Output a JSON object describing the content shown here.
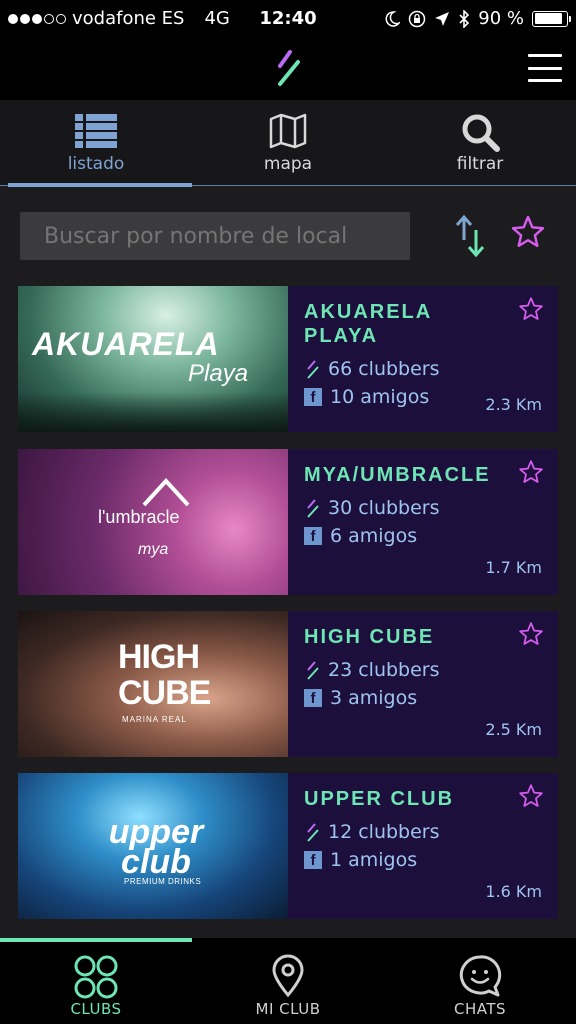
{
  "status_bar": {
    "carrier": "vodafone ES",
    "network": "4G",
    "time": "12:40",
    "battery": "90 %",
    "battery_level": 0.9
  },
  "tabs": [
    {
      "label": "listado",
      "icon": "list-icon",
      "active": true
    },
    {
      "label": "mapa",
      "icon": "map-icon",
      "active": false
    },
    {
      "label": "filtrar",
      "icon": "search-icon",
      "active": false
    }
  ],
  "search": {
    "placeholder": "Buscar por nombre de local",
    "value": ""
  },
  "clubs": [
    {
      "name": "AKUARELA PLAYA",
      "clubbers": "66 clubbers",
      "amigos": "10 amigos",
      "distance": "2.3 Km",
      "image_text": "AKUARELA",
      "image_subtext": "Playa"
    },
    {
      "name": "MYA/UMBRACLE",
      "clubbers": "30 clubbers",
      "amigos": "6 amigos",
      "distance": "1.7 Km",
      "image_text": "l'umbracle",
      "image_subtext": "mya"
    },
    {
      "name": "HIGH CUBE",
      "clubbers": "23 clubbers",
      "amigos": "3 amigos",
      "distance": "2.5 Km",
      "image_text": "HIGH CUBE",
      "image_subtext": "MARINA REAL"
    },
    {
      "name": "UPPER CLUB",
      "clubbers": "12 clubbers",
      "amigos": "1 amigos",
      "distance": "1.6 Km",
      "image_text": "upper club",
      "image_subtext": "PREMIUM DRINKS"
    }
  ],
  "bottom_nav": [
    {
      "label": "CLUBS",
      "icon": "clubs-icon",
      "active": true
    },
    {
      "label": "MI CLUB",
      "icon": "location-pin-icon",
      "active": false
    },
    {
      "label": "CHATS",
      "icon": "chat-bubble-icon",
      "active": false
    }
  ],
  "colors": {
    "accent_green": "#6ee5b4",
    "accent_blue": "#7fa3d2",
    "favorite_pink": "#d85cf0",
    "card_info_bg": "#1d0f3c"
  }
}
